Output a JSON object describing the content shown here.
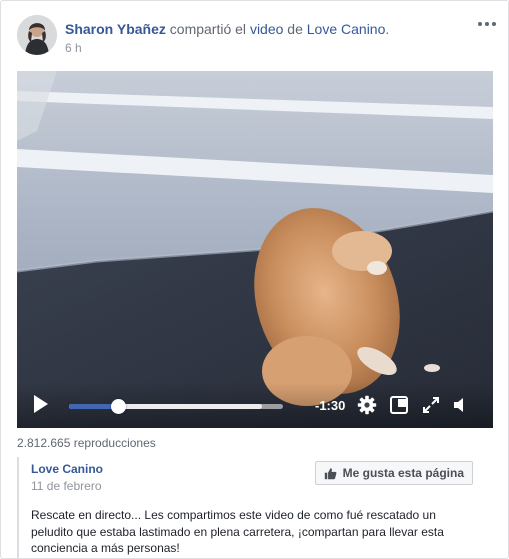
{
  "post": {
    "author": "Sharon Ybañez",
    "action_text": "compartió el",
    "object_link": "video",
    "connector": "de",
    "source_page": "Love Canino",
    "punctuation": ".",
    "timestamp": "6 h"
  },
  "video": {
    "remaining_time": "-1:30",
    "progress_fraction": 0.23,
    "buffered_fraction": 0.9
  },
  "views_text": "2.812.665 reproducciones",
  "shared_page": {
    "name": "Love Canino",
    "date": "11 de febrero",
    "like_button_label": "Me gusta esta página",
    "description": "Rescate en directo... Les compartimos este video de como fué rescatado un peludito que estaba lastimado en plena carretera, ¡compartan para llevar esta conciencia a más personas!"
  },
  "colors": {
    "link": "#365899",
    "progress": "#4267b2",
    "muted": "#616770"
  },
  "icons": [
    "avatar-photo",
    "more-options-icon",
    "play-icon",
    "settings-gear-icon",
    "picture-in-picture-icon",
    "fullscreen-icon",
    "volume-icon",
    "thumbs-up-icon"
  ]
}
